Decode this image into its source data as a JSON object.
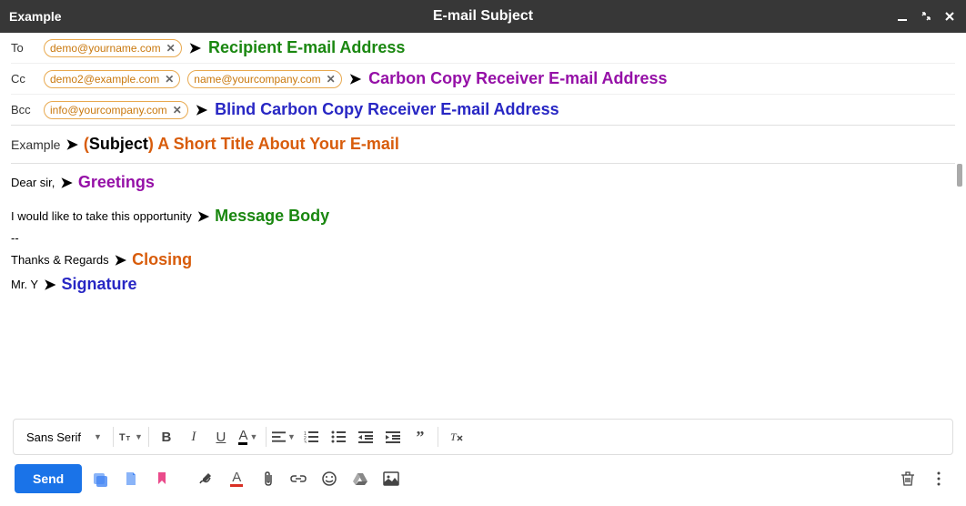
{
  "titlebar": {
    "left_label": "Example",
    "center_title": "E-mail Subject"
  },
  "fields": {
    "to_label": "To",
    "cc_label": "Cc",
    "bcc_label": "Bcc",
    "to_chips": [
      "demo@yourname.com"
    ],
    "cc_chips": [
      "demo2@example.com",
      "name@yourcompany.com"
    ],
    "bcc_chips": [
      "info@yourcompany.com"
    ]
  },
  "subject": {
    "value": "Example",
    "annotation_prefix": "(",
    "annotation_word": "Subject",
    "annotation_suffix": ")",
    "annotation_desc": "A Short Title About Your E-mail"
  },
  "annotations": {
    "to": "Recipient E-mail Address",
    "cc": "Carbon Copy Receiver E-mail Address",
    "bcc": "Blind Carbon Copy Receiver E-mail Address",
    "greeting": "Greetings",
    "body": "Message Body",
    "closing": "Closing",
    "signature": "Signature"
  },
  "body": {
    "greeting": "Dear sir,",
    "message": "I would like to take this opportunity",
    "separator": "--",
    "closing": "Thanks & Regards",
    "signature": "Mr. Y"
  },
  "format_toolbar": {
    "font_family": "Sans Serif"
  },
  "buttons": {
    "send": "Send"
  }
}
